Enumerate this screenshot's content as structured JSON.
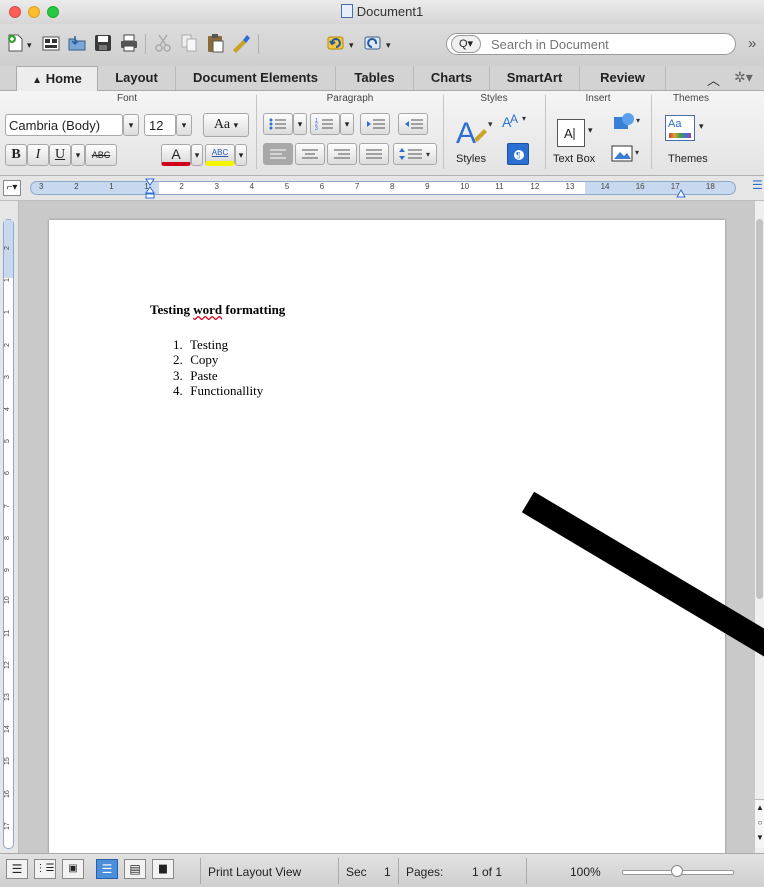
{
  "window": {
    "title": "Document1"
  },
  "toolbar": {
    "search_placeholder": "Search in Document",
    "overflow": "»"
  },
  "tabs": [
    "Home",
    "Layout",
    "Document Elements",
    "Tables",
    "Charts",
    "SmartArt",
    "Review"
  ],
  "ribbon": {
    "font_group": "Font",
    "paragraph_group": "Paragraph",
    "styles_group": "Styles",
    "insert_group": "Insert",
    "themes_group": "Themes",
    "font_name": "Cambria (Body)",
    "font_size": "12",
    "font_size_glyph": "Aa",
    "bold": "B",
    "italic": "I",
    "underline": "U",
    "strikethrough": "ABC",
    "font_color": "A",
    "highlight": "ABC",
    "styles_label": "Styles",
    "text_box_label": "Text Box",
    "themes_label": "Themes",
    "theme_swatch": "Aa"
  },
  "ruler": {
    "labels": [
      "3",
      "2",
      "1",
      "1",
      "2",
      "3",
      "4",
      "5",
      "6",
      "7",
      "8",
      "9",
      "10",
      "11",
      "12",
      "13",
      "14",
      "16",
      "17",
      "18"
    ]
  },
  "vruler": {
    "labels": [
      "2",
      "1",
      "1",
      "2",
      "3",
      "4",
      "5",
      "6",
      "7",
      "8",
      "9",
      "10",
      "11",
      "12",
      "13",
      "14",
      "15",
      "16",
      "17"
    ]
  },
  "document": {
    "heading_before": "Testing ",
    "heading_misspelled": "word",
    "heading_after": " formatting",
    "list": [
      {
        "num": "1.",
        "text": "Testing"
      },
      {
        "num": "2.",
        "text": "Copy"
      },
      {
        "num": "3.",
        "text": "Paste"
      },
      {
        "num": "4.",
        "text": "Functionallity"
      }
    ]
  },
  "status": {
    "view_label": "Print Layout View",
    "sec_label": "Sec",
    "sec_value": "1",
    "pages_label": "Pages:",
    "pages_value": "1 of 1",
    "zoom": "100%"
  },
  "colors": {
    "misspelling_underline": "#d0021b",
    "annotation_stroke": "#000000",
    "active_view": "#4a8fdc",
    "ruler_margin": "#c8d9ef"
  },
  "icons": [
    "new-doc-icon",
    "templates-icon",
    "open-icon",
    "save-icon",
    "print-icon",
    "cut-icon",
    "copy-icon",
    "paste-icon",
    "format-painter-icon",
    "undo-icon",
    "redo-icon",
    "search-icon",
    "home-icon",
    "collapse-ribbon-icon",
    "gear-icon"
  ]
}
